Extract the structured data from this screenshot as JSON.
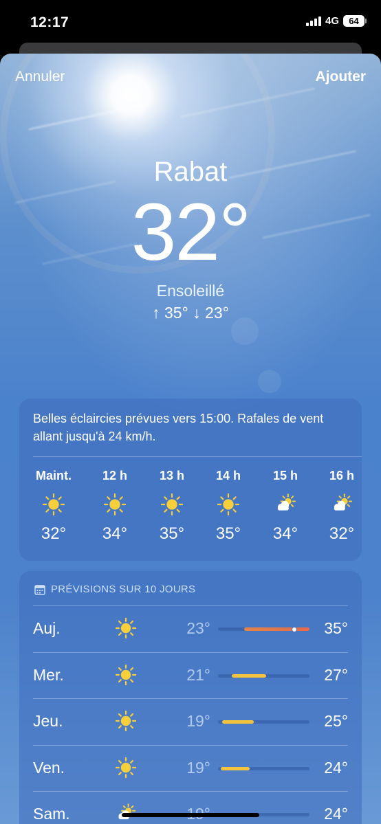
{
  "status_bar": {
    "time": "12:17",
    "network": "4G",
    "battery": "64"
  },
  "nav": {
    "cancel": "Annuler",
    "add": "Ajouter"
  },
  "current": {
    "city": "Rabat",
    "temperature": "32°",
    "condition": "Ensoleillé",
    "high_low": "↑ 35°  ↓ 23°"
  },
  "hourly": {
    "summary": "Belles éclaircies prévues vers 15:00. Rafales de vent allant jusqu'à 24 km/h.",
    "hours": [
      {
        "label": "Maint.",
        "icon": "sun-icon",
        "temp": "32°"
      },
      {
        "label": "12 h",
        "icon": "sun-icon",
        "temp": "34°"
      },
      {
        "label": "13 h",
        "icon": "sun-icon",
        "temp": "35°"
      },
      {
        "label": "14 h",
        "icon": "sun-icon",
        "temp": "35°"
      },
      {
        "label": "15 h",
        "icon": "partly-cloudy-icon",
        "temp": "34°"
      },
      {
        "label": "16 h",
        "icon": "partly-cloudy-icon",
        "temp": "32°"
      }
    ]
  },
  "daily": {
    "header": "PRÉVISIONS SUR 10 JOURS",
    "days": [
      {
        "name": "Auj.",
        "icon": "sun-icon",
        "low": "23°",
        "high": "35°"
      },
      {
        "name": "Mer.",
        "icon": "sun-icon",
        "low": "21°",
        "high": "27°"
      },
      {
        "name": "Jeu.",
        "icon": "sun-icon",
        "low": "19°",
        "high": "25°"
      },
      {
        "name": "Ven.",
        "icon": "sun-icon",
        "low": "19°",
        "high": "24°"
      },
      {
        "name": "Sam.",
        "icon": "partly-cloudy-icon",
        "low": "19°",
        "high": "24°"
      }
    ]
  },
  "colors": {
    "sun": "#f7cf3b",
    "bar_warm": "#e8844a",
    "bar_mild": "#f3c43c",
    "bar_hot": "#ef6a4a"
  }
}
